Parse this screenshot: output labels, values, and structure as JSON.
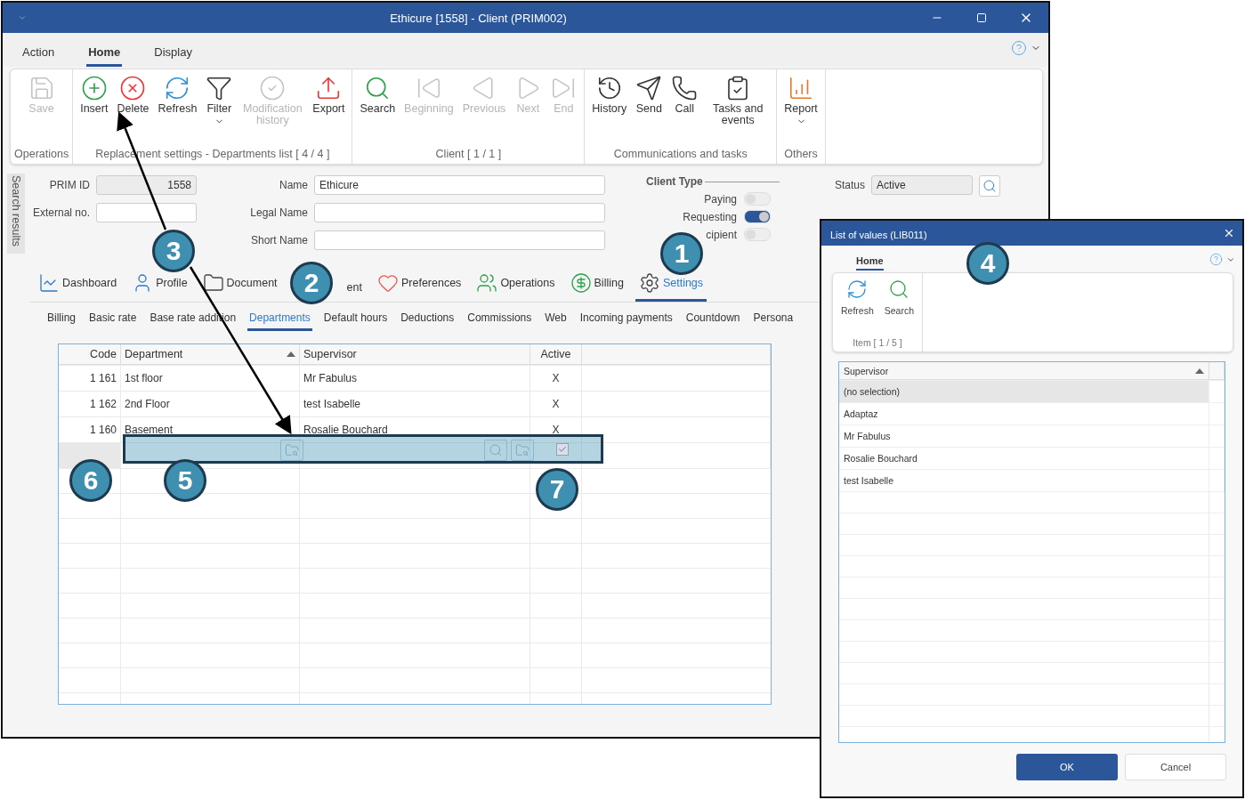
{
  "main_window": {
    "title": "Ethicure [1558] - Client (PRIM002)",
    "menu_tabs": [
      {
        "label": "Action",
        "selected": false
      },
      {
        "label": "Home",
        "selected": true
      },
      {
        "label": "Display",
        "selected": false
      }
    ],
    "ribbon_groups": [
      {
        "label": "Operations",
        "buttons": [
          {
            "label": "Save",
            "disabled": true,
            "dropdown": false
          }
        ]
      },
      {
        "label": "Replacement settings - Departments list [ 4 / 4 ]",
        "buttons": [
          {
            "label": "Insert",
            "disabled": false,
            "dropdown": false
          },
          {
            "label": "Delete",
            "disabled": false,
            "dropdown": false
          },
          {
            "label": "Refresh",
            "disabled": false,
            "dropdown": false
          },
          {
            "label": "Filter",
            "disabled": false,
            "dropdown": true
          },
          {
            "label": "Modification history",
            "disabled": true,
            "dropdown": false
          },
          {
            "label": "Export",
            "disabled": false,
            "dropdown": false
          }
        ]
      },
      {
        "label": "Client [ 1 / 1 ]",
        "buttons": [
          {
            "label": "Search",
            "disabled": false,
            "dropdown": false
          },
          {
            "label": "Beginning",
            "disabled": true,
            "dropdown": false
          },
          {
            "label": "Previous",
            "disabled": true,
            "dropdown": false
          },
          {
            "label": "Next",
            "disabled": true,
            "dropdown": false
          },
          {
            "label": "End",
            "disabled": true,
            "dropdown": false
          }
        ]
      },
      {
        "label": "Communications and tasks",
        "buttons": [
          {
            "label": "History",
            "disabled": false,
            "dropdown": false
          },
          {
            "label": "Send",
            "disabled": false,
            "dropdown": false
          },
          {
            "label": "Call",
            "disabled": false,
            "dropdown": false
          },
          {
            "label": "Tasks and events",
            "disabled": false,
            "dropdown": false
          }
        ]
      },
      {
        "label": "Others",
        "buttons": [
          {
            "label": "Report",
            "disabled": false,
            "dropdown": true
          }
        ]
      }
    ],
    "side_panel": {
      "label": "Search results"
    },
    "form": {
      "left_fields": [
        {
          "label": "PRIM ID",
          "value": "1558",
          "disabled": true
        },
        {
          "label": "External no.",
          "disabled": false
        }
      ],
      "middle_fields": [
        {
          "label": "Name",
          "value": "Ethicure"
        },
        {
          "label": "Legal Name"
        },
        {
          "label": "Short Name"
        }
      ],
      "client_type": {
        "title": "Client Type",
        "options": [
          {
            "label": "Paying",
            "on": false
          },
          {
            "label": "Requesting",
            "on": true
          },
          {
            "label": "cipient",
            "on": false
          }
        ]
      },
      "status": {
        "label": "Status",
        "value": "Active"
      }
    },
    "section_tabs": [
      {
        "label": "Dashboard",
        "selected": false
      },
      {
        "label": "Profile",
        "selected": false
      },
      {
        "label": "Document",
        "selected": false
      },
      {
        "label": "ent",
        "selected": false
      },
      {
        "label": "Preferences",
        "selected": false
      },
      {
        "label": "Operations",
        "selected": false
      },
      {
        "label": "Billing",
        "selected": false
      },
      {
        "label": "Settings",
        "selected": true
      }
    ],
    "sub_tabs": [
      {
        "label": "Billing",
        "selected": false
      },
      {
        "label": "Basic rate",
        "selected": false
      },
      {
        "label": "Base rate addition",
        "selected": false
      },
      {
        "label": "Departments",
        "selected": true
      },
      {
        "label": "Default hours",
        "selected": false
      },
      {
        "label": "Deductions",
        "selected": false
      },
      {
        "label": "Commissions",
        "selected": false
      },
      {
        "label": "Web",
        "selected": false
      },
      {
        "label": "Incoming payments",
        "selected": false
      },
      {
        "label": "Countdown",
        "selected": false
      },
      {
        "label": "Persona",
        "selected": false
      }
    ],
    "table": {
      "columns": [
        {
          "label": "Code",
          "sorted": false
        },
        {
          "label": "Department",
          "sorted": true
        },
        {
          "label": "Supervisor",
          "sorted": false
        },
        {
          "label": "Active",
          "sorted": false
        }
      ],
      "rows": [
        {
          "code": "1 161",
          "department": "1st floor",
          "supervisor": "Mr Fabulus",
          "active": "X"
        },
        {
          "code": "1 162",
          "department": "2nd Floor",
          "supervisor": "test Isabelle",
          "active": "X"
        },
        {
          "code": "1 160",
          "department": "Basement",
          "supervisor": "Rosalie Bouchard",
          "active": "X"
        }
      ],
      "new_row": {
        "active_checked": true
      }
    }
  },
  "dialog": {
    "title": "List of values (LIB011)",
    "tabs": [
      {
        "label": "Home",
        "selected": true
      }
    ],
    "buttons": [
      {
        "label": "Refresh"
      },
      {
        "label": "Search"
      }
    ],
    "group_label": "Item [ 1 / 5 ]",
    "column": "Supervisor",
    "rows": [
      {
        "label": "(no selection)",
        "selected": true
      },
      {
        "label": "Adaptaz",
        "selected": false
      },
      {
        "label": "Mr Fabulus",
        "selected": false
      },
      {
        "label": "Rosalie Bouchard",
        "selected": false
      },
      {
        "label": "test Isabelle",
        "selected": false
      }
    ],
    "ok": "OK",
    "cancel": "Cancel"
  },
  "callouts": [
    {
      "number": "1"
    },
    {
      "number": "2"
    },
    {
      "number": "3"
    },
    {
      "number": "4"
    },
    {
      "number": "6"
    },
    {
      "number": "5"
    },
    {
      "number": "7"
    }
  ]
}
